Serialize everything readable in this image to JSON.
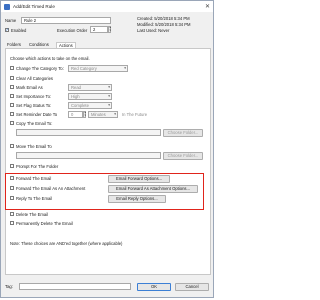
{
  "window": {
    "title": "Add/Edit Timed Rule",
    "close": "✕"
  },
  "header": {
    "name_label": "Name",
    "name_value": "Rule 2",
    "created": "Created: 5/20/2018 5:34 PM",
    "modified": "Modified: 5/20/2018 5:34 PM",
    "last_used": "Last Used: Never",
    "enabled_label": "Enabled",
    "enabled": true,
    "exec_order_label": "Execution Order",
    "exec_order_value": "2"
  },
  "tabs": [
    {
      "label": "Folders"
    },
    {
      "label": "Conditions"
    },
    {
      "label": "Actions"
    }
  ],
  "active_tab": "Actions",
  "actions": {
    "intro": "Choose which actions to take on the email.",
    "rows": [
      {
        "label": "Change The Category To:",
        "value": "Red Category"
      },
      {
        "label": "Clear All Categories"
      },
      {
        "label": "Mark Email As",
        "value": "Read"
      },
      {
        "label": "Set Importance To:",
        "value": "High"
      },
      {
        "label": "Set Flag Status To:",
        "value": "Complete"
      },
      {
        "label": "Set Reminder Date To",
        "value": "0",
        "unit": "Minutes",
        "suffix": "In The Future"
      },
      {
        "label": "Copy The Email To:",
        "button": "Choose Folder..."
      },
      {
        "label": "Move The Email To",
        "button": "Choose Folder..."
      },
      {
        "label": "Prompt For The Folder"
      },
      {
        "label": "Forward The Email",
        "button": "Email Forward Options..."
      },
      {
        "label": "Forward The Email As An Attachment",
        "button": "Email Forward As Attachment Options..."
      },
      {
        "label": "Reply To The Email",
        "button": "Email Reply Options..."
      },
      {
        "label": "Delete The Email"
      },
      {
        "label": "Permanently Delete The Email"
      }
    ],
    "note": "Note: These choices are AND'ed together (where applicable)"
  },
  "footer": {
    "tag_label": "Tag:",
    "tag_value": "",
    "ok_label": "OK",
    "cancel_label": "Cancel"
  },
  "colors": {
    "highlight_border": "#e0241b",
    "accent": "#3a6fc4"
  }
}
